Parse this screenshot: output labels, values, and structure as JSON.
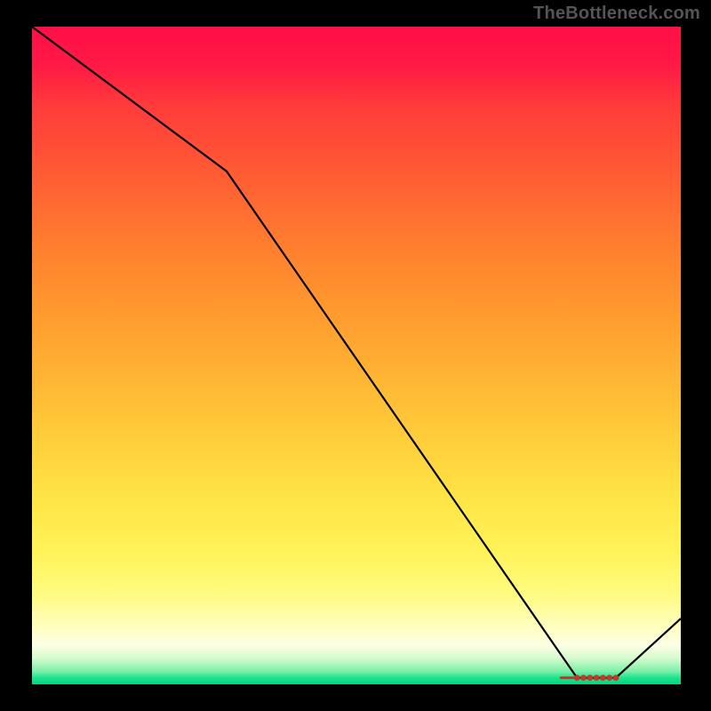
{
  "attribution": "TheBottleneck.com",
  "chart_data": {
    "type": "line",
    "title": "",
    "xlabel": "",
    "ylabel": "",
    "xlim": [
      0,
      100
    ],
    "ylim": [
      0,
      100
    ],
    "x": [
      0,
      30,
      84,
      90,
      100
    ],
    "values": [
      100,
      78,
      1,
      1,
      10
    ],
    "marker_region": {
      "x_start": 84,
      "x_end": 90,
      "y": 1
    },
    "gradient_stops": [
      {
        "pos": 0,
        "color": "#ff0f47"
      },
      {
        "pos": 50,
        "color": "#ffb133"
      },
      {
        "pos": 85,
        "color": "#fffb7e"
      },
      {
        "pos": 100,
        "color": "#06d67e"
      }
    ]
  }
}
